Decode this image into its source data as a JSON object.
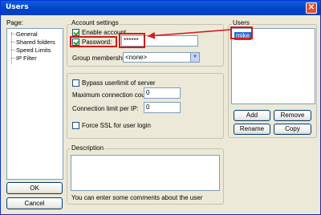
{
  "window": {
    "title": "Users",
    "close_glyph": "✕"
  },
  "page_panel": {
    "label": "Page:",
    "items": [
      "General",
      "Shared folders",
      "Speed Limits",
      "IP Filter"
    ]
  },
  "account_settings": {
    "label": "Account settings",
    "enable_account": {
      "label": "Enable account",
      "checked": true
    },
    "password": {
      "label": "Password:",
      "checked": true,
      "value": "******"
    },
    "group_membership": {
      "label": "Group membership:",
      "value": "<none>"
    }
  },
  "limits": {
    "bypass": {
      "label": "Bypass userlimit of server",
      "checked": false
    },
    "max_connections": {
      "label": "Maximum connection count:",
      "value": "0"
    },
    "conn_limit_ip": {
      "label": "Connection limit per IP:",
      "value": "0"
    },
    "force_ssl": {
      "label": "Force SSL for user login",
      "checked": false
    }
  },
  "description": {
    "label": "Description",
    "hint": "You can enter some comments about the user",
    "value": ""
  },
  "users": {
    "label": "Users",
    "items": [
      "mike"
    ],
    "selected": "mike",
    "buttons": {
      "add": "Add",
      "remove": "Remove",
      "rename": "Rename",
      "copy": "Copy"
    }
  },
  "dialog_buttons": {
    "ok": "OK",
    "cancel": "Cancel"
  },
  "annotation_color": "#d11b1b",
  "selection_color": "#316ac5"
}
